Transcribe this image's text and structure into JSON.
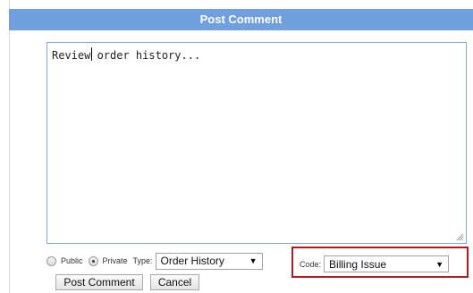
{
  "window": {
    "title": "Post Comment"
  },
  "comment": {
    "value": "Review order history..."
  },
  "visibility": {
    "public_label": "Public",
    "private_label": "Private",
    "selected": "Private"
  },
  "type_field": {
    "label": "Type:",
    "value": "Order History"
  },
  "code_field": {
    "label": "Code:",
    "value": "Billing Issue"
  },
  "buttons": {
    "post_label": "Post Comment",
    "cancel_label": "Cancel"
  },
  "colors": {
    "title_bar": "#6f9fdc",
    "highlight_border": "#b01b22"
  }
}
